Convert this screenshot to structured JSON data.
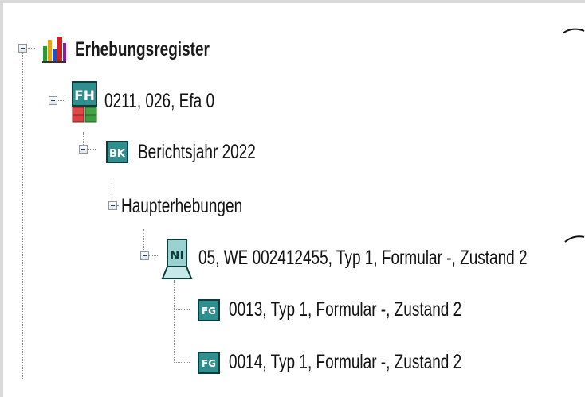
{
  "tree": {
    "root": {
      "label": "Erhebungsregister",
      "icon": "bar-chart-icon"
    },
    "efa": {
      "label": "0211, 026,  Efa 0",
      "icon": "fh-icon",
      "icon_text": "FH"
    },
    "year": {
      "label": "Berichtsjahr 2022",
      "icon": "bk-icon",
      "icon_text": "BK"
    },
    "group": {
      "label": "Haupterhebungen"
    },
    "we": {
      "label": "05, WE 002412455, Typ 1, Formular -, Zustand 2",
      "icon": "we-icon",
      "icon_text": "NI"
    },
    "fg1": {
      "label": "0013, Typ 1, Formular -, Zustand 2",
      "icon": "fg-icon",
      "icon_text": "FG"
    },
    "fg2": {
      "label": "0014, Typ 1, Formular -, Zustand 2",
      "icon": "fg-icon",
      "icon_text": "FG"
    }
  },
  "colors": {
    "background": "#d9d9d9",
    "panel": "#ffffff",
    "icon_teal": "#2f8f8f",
    "icon_dark": "#0b3d3d",
    "expander_border": "#8a97a8"
  }
}
